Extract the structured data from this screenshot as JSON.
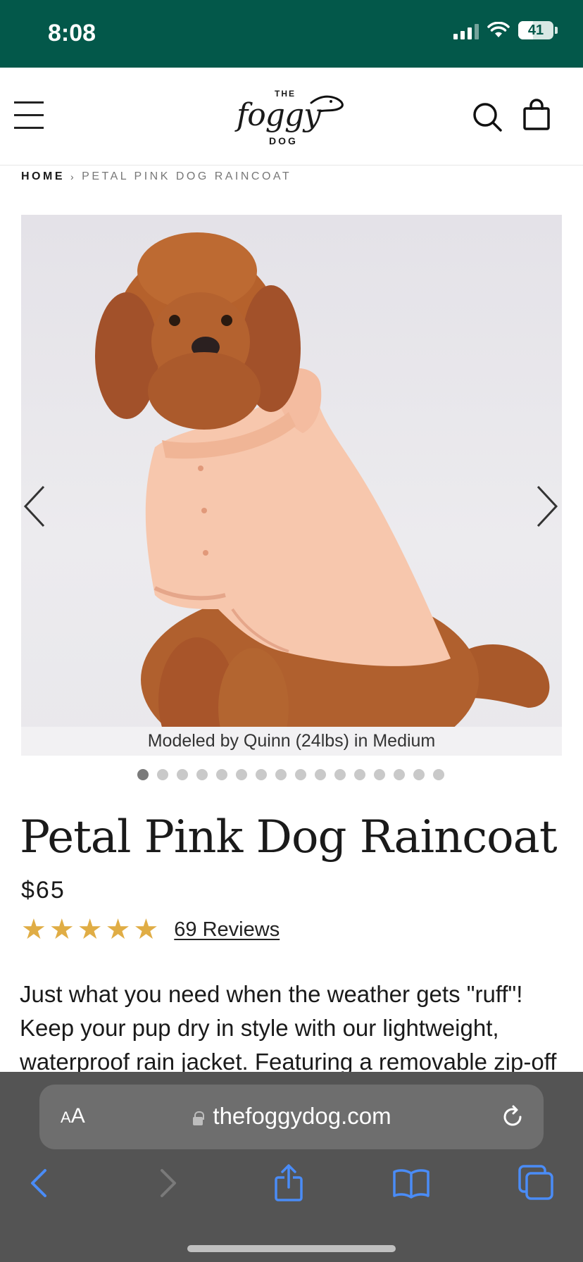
{
  "status_bar": {
    "time": "8:08",
    "battery": "41"
  },
  "header": {
    "logo": {
      "top": "THE",
      "main": "foggy",
      "bottom": "DOG"
    }
  },
  "breadcrumb": {
    "home": "HOME",
    "separator": "›",
    "current": "PETAL PINK DOG RAINCOAT"
  },
  "gallery": {
    "caption": "Modeled by Quinn (24lbs) in Medium",
    "total_images": 16,
    "active_index": 0
  },
  "product": {
    "title": "Petal Pink Dog Raincoat",
    "price": "$65",
    "rating": 5,
    "reviews_label": "69 Reviews",
    "description": "Just what you need when the weather gets \"ruff\"! Keep your pup dry in style with our lightweight, waterproof rain jacket. Featuring a removable zip-off hood,"
  },
  "browser": {
    "text_size_label": "AA",
    "url": "thefoggydog.com"
  },
  "colors": {
    "status_bar_bg": "#03584a",
    "star": "#e0ad45",
    "safari_blue": "#4a8cf7"
  }
}
